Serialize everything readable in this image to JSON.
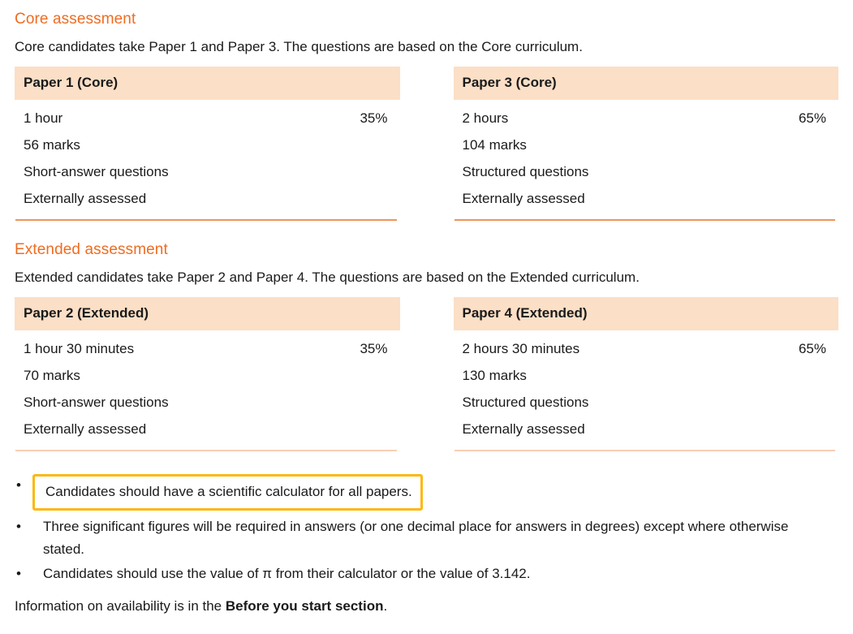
{
  "core": {
    "heading": "Core assessment",
    "intro": "Core candidates take Paper 1 and Paper 3. The questions are based on the Core curriculum.",
    "papers": [
      {
        "title": "Paper 1 (Core)",
        "duration": "1 hour",
        "weight": "35%",
        "marks": "56 marks",
        "question_type": "Short-answer questions",
        "assessment": "Externally assessed"
      },
      {
        "title": "Paper 3 (Core)",
        "duration": "2 hours",
        "weight": "65%",
        "marks": "104 marks",
        "question_type": "Structured questions",
        "assessment": "Externally assessed"
      }
    ]
  },
  "extended": {
    "heading": "Extended assessment",
    "intro": "Extended candidates take Paper 2 and Paper 4. The questions are based on the Extended curriculum.",
    "papers": [
      {
        "title": "Paper 2 (Extended)",
        "duration": "1 hour 30 minutes",
        "weight": "35%",
        "marks": "70 marks",
        "question_type": "Short-answer questions",
        "assessment": "Externally assessed"
      },
      {
        "title": "Paper 4 (Extended)",
        "duration": "2 hours 30 minutes",
        "weight": "65%",
        "marks": "130 marks",
        "question_type": "Structured questions",
        "assessment": "Externally assessed"
      }
    ]
  },
  "notes": [
    "Candidates should have a scientific calculator for all papers.",
    "Three significant figures will be required in answers (or one decimal place for answers in degrees) except where otherwise stated.",
    "Candidates should use the value of π from their calculator or the value of 3.142."
  ],
  "closing": {
    "before": "Information on availability is in the ",
    "bold": "Before you start section",
    "after": "."
  },
  "colors": {
    "heading_orange": "#ef6c21",
    "card_header_bg": "#fbdfc6",
    "rule_strong": "#f0945a",
    "rule_light": "#f8cfb4",
    "highlight_border": "#fcb813",
    "text": "#1a1a1a"
  }
}
